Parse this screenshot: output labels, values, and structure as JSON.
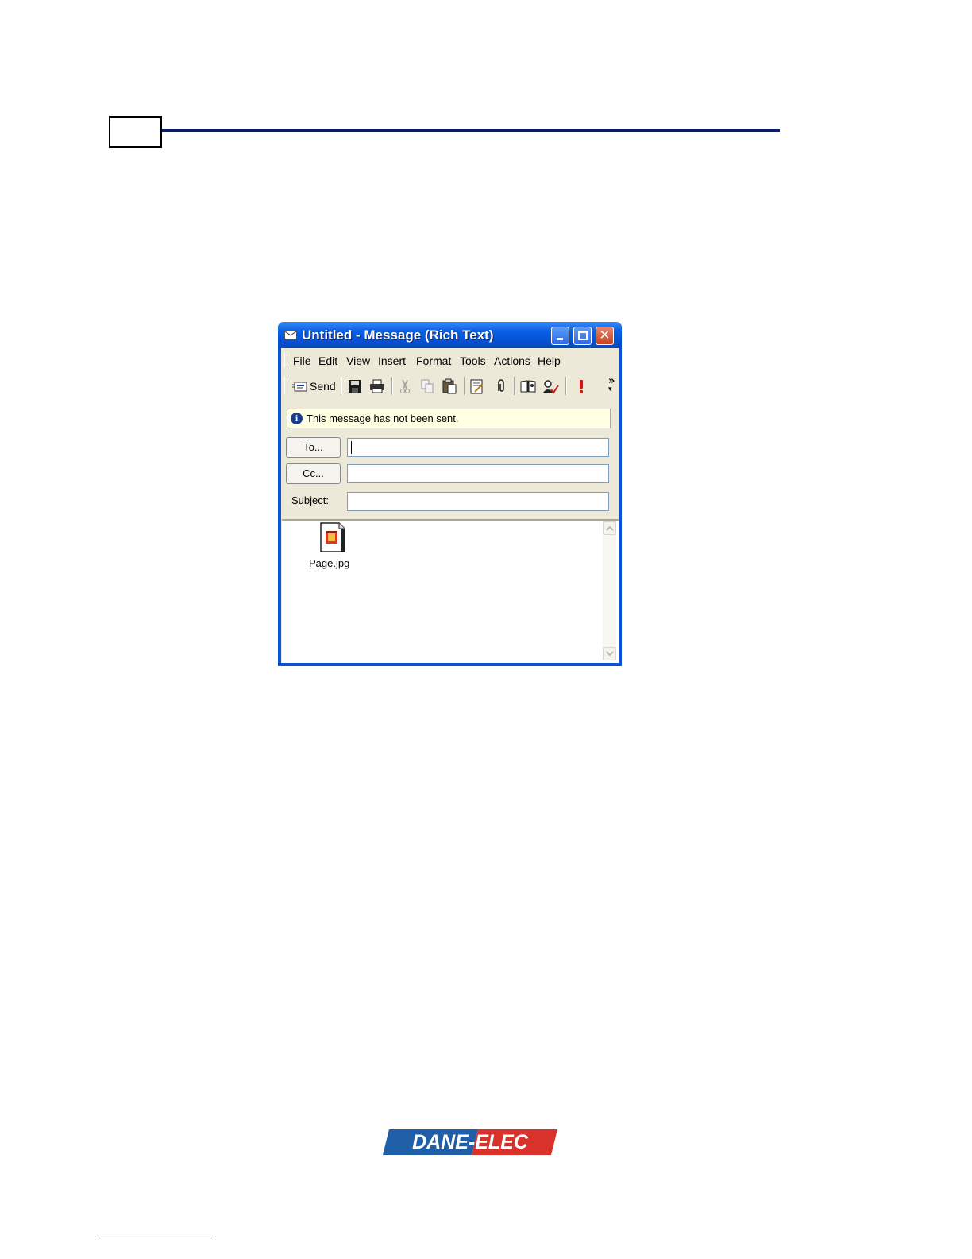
{
  "window": {
    "title": "Untitled - Message (Rich Text)",
    "menu": [
      "File",
      "Edit",
      "View",
      "Insert",
      "Format",
      "Tools",
      "Actions",
      "Help"
    ],
    "toolbar": {
      "send_label": "Send",
      "icons": [
        "save-icon",
        "print-icon",
        "cut-icon",
        "copy-icon",
        "paste-icon",
        "insert-file-icon",
        "attach-icon",
        "address-book-icon",
        "check-names-icon",
        "importance-high-icon"
      ]
    },
    "info_message": "This message has not been sent.",
    "fields": {
      "to_label": "To...",
      "cc_label": "Cc...",
      "subject_label": "Subject:",
      "to_value": "",
      "cc_value": "",
      "subject_value": ""
    },
    "attachment": {
      "name": "Page.jpg"
    }
  },
  "logo": {
    "text": "DANE-ELEC"
  },
  "colors": {
    "header_rule": "#0a1a6e",
    "titlebar": "#0a5fe6",
    "logo_blue": "#1f5fa8",
    "logo_red": "#d8322a"
  }
}
